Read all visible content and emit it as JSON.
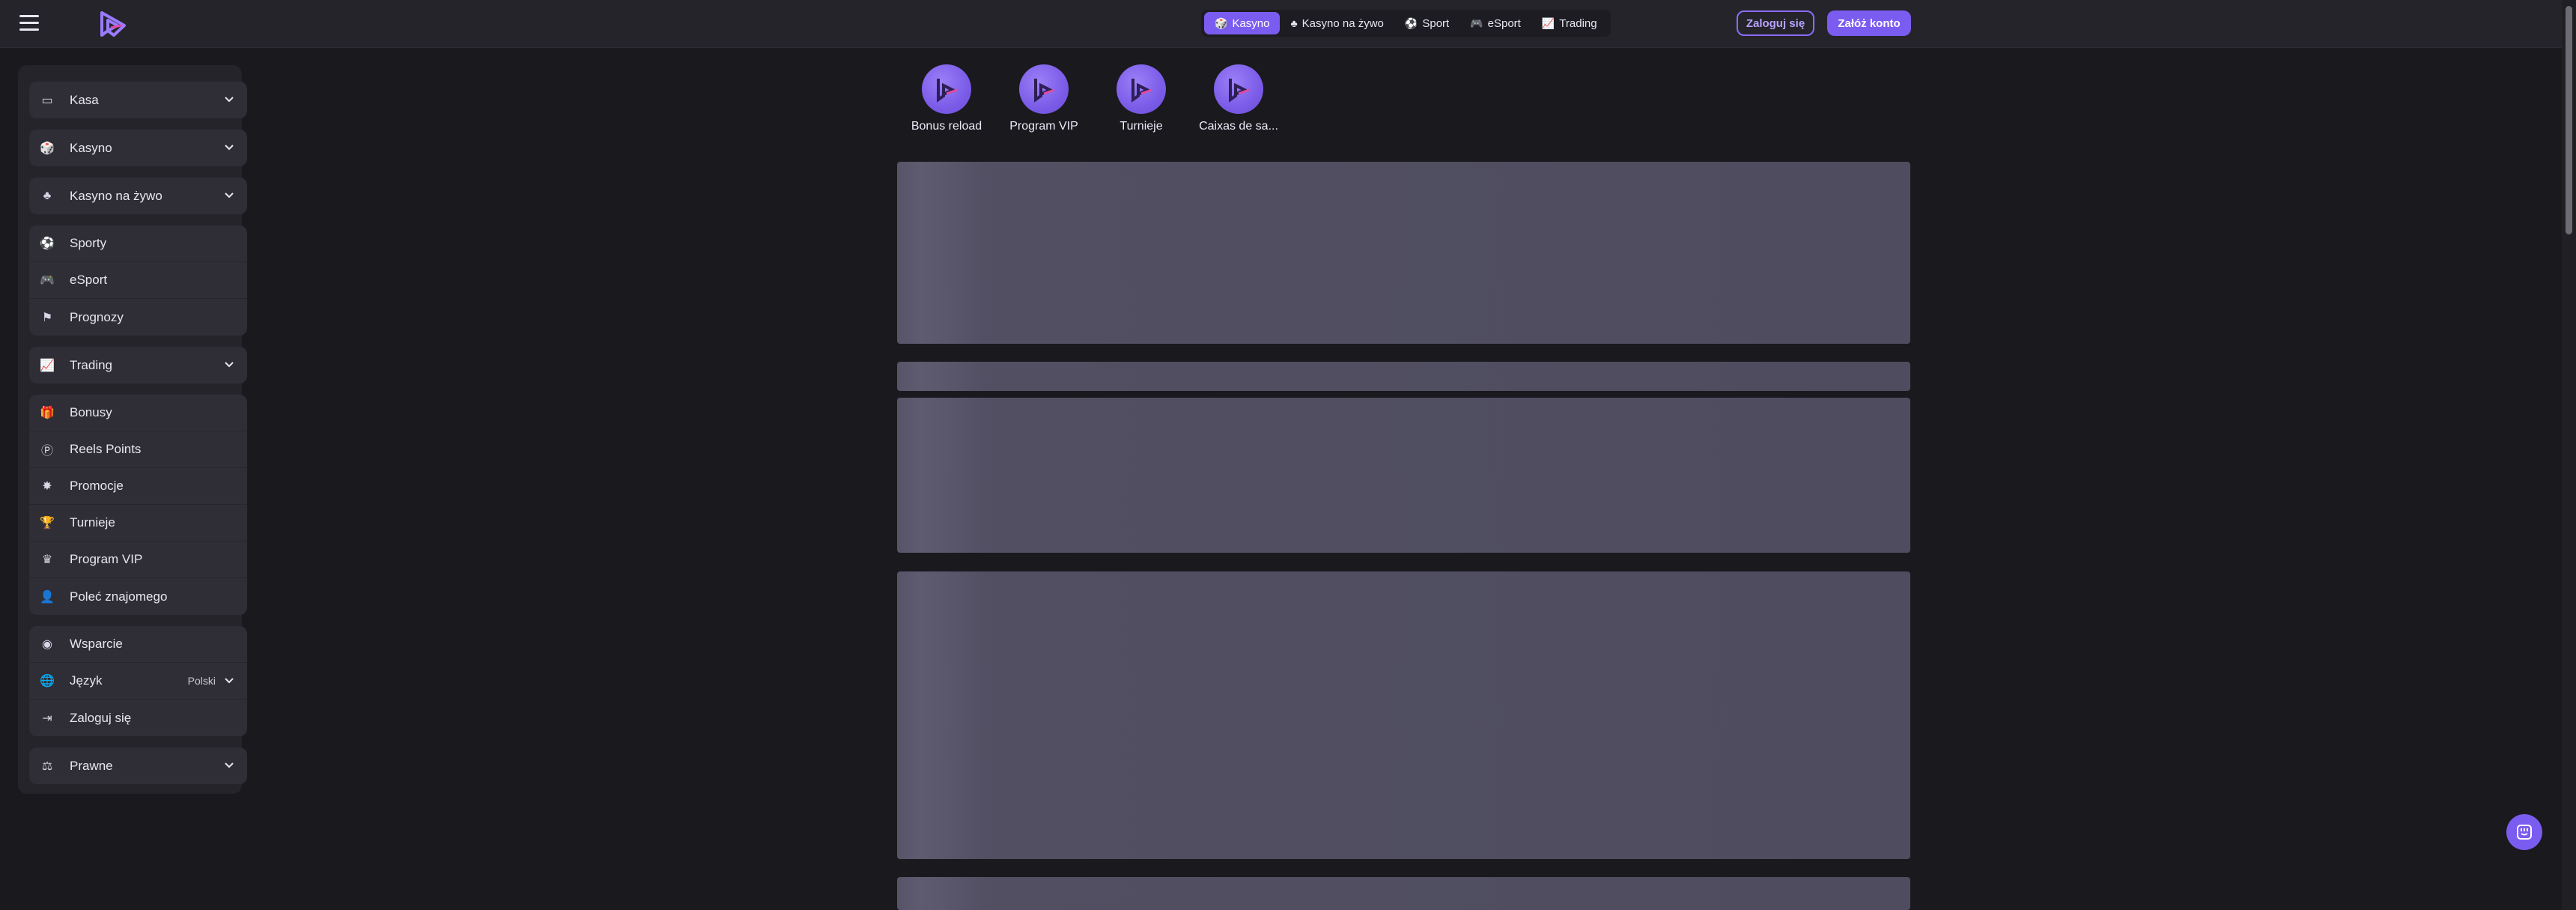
{
  "header": {
    "nav_tabs": [
      {
        "label": "Kasyno",
        "icon": "casino-icon",
        "active": true
      },
      {
        "label": "Kasyno na żywo",
        "icon": "live-casino-icon",
        "active": false
      },
      {
        "label": "Sport",
        "icon": "ball-icon",
        "active": false
      },
      {
        "label": "eSport",
        "icon": "gamepad-icon",
        "active": false
      },
      {
        "label": "Trading",
        "icon": "chart-icon",
        "active": false
      }
    ],
    "login_label": "Zaloguj się",
    "register_label": "Załóż konto"
  },
  "sidebar": {
    "groups": [
      {
        "items": [
          {
            "label": "Kasa",
            "icon": "wallet-icon",
            "expandable": true
          }
        ]
      },
      {
        "items": [
          {
            "label": "Kasyno",
            "icon": "casino-icon",
            "expandable": true
          }
        ]
      },
      {
        "items": [
          {
            "label": "Kasyno na żywo",
            "icon": "live-casino-icon",
            "expandable": true
          }
        ]
      },
      {
        "items": [
          {
            "label": "Sporty",
            "icon": "ball-icon"
          },
          {
            "label": "eSport",
            "icon": "gamepad-icon"
          },
          {
            "label": "Prognozy",
            "icon": "prediction-icon"
          }
        ]
      },
      {
        "items": [
          {
            "label": "Trading",
            "icon": "chart-icon",
            "expandable": true
          }
        ]
      },
      {
        "items": [
          {
            "label": "Bonusy",
            "icon": "gift-icon"
          },
          {
            "label": "Reels Points",
            "icon": "points-icon"
          },
          {
            "label": "Promocje",
            "icon": "promo-icon"
          },
          {
            "label": "Turnieje",
            "icon": "trophy-icon"
          },
          {
            "label": "Program VIP",
            "icon": "crown-icon"
          },
          {
            "label": "Poleć znajomego",
            "icon": "person-icon"
          }
        ]
      },
      {
        "items": [
          {
            "label": "Wsparcie",
            "icon": "support-icon"
          },
          {
            "label": "Język",
            "icon": "globe-icon",
            "value": "Polski"
          },
          {
            "label": "Zaloguj się",
            "icon": "login-icon"
          }
        ]
      },
      {
        "items": [
          {
            "label": "Prawne",
            "icon": "scale-icon",
            "expandable": true
          }
        ]
      }
    ]
  },
  "promos": [
    {
      "label": "Bonus reload"
    },
    {
      "label": "Program VIP"
    },
    {
      "label": "Turnieje"
    },
    {
      "label": "Caixas de sa..."
    }
  ],
  "colors": {
    "accent": "#7b5cf0",
    "background": "#1a191e",
    "panel": "#25242b",
    "sidebar_item": "#2f2e36",
    "skeleton": "#57546a"
  }
}
